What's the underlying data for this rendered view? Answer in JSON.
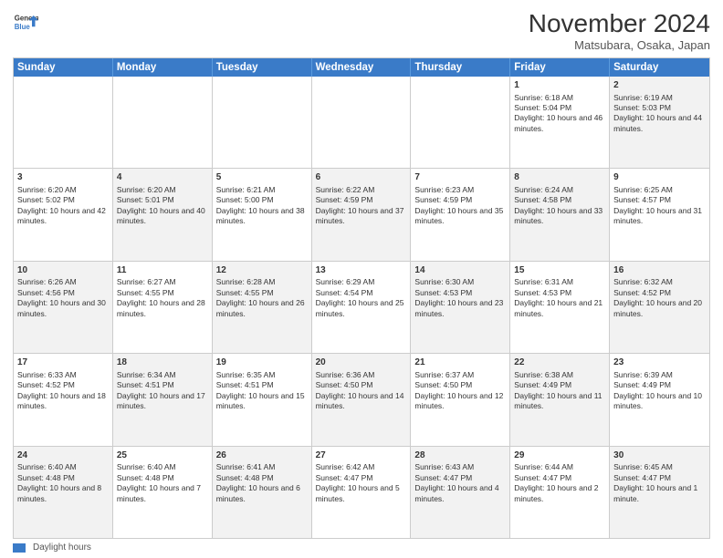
{
  "header": {
    "logo_line1": "General",
    "logo_line2": "Blue",
    "month": "November 2024",
    "location": "Matsubara, Osaka, Japan"
  },
  "weekdays": [
    "Sunday",
    "Monday",
    "Tuesday",
    "Wednesday",
    "Thursday",
    "Friday",
    "Saturday"
  ],
  "weeks": [
    [
      {
        "day": "",
        "info": "",
        "shaded": false,
        "empty": true
      },
      {
        "day": "",
        "info": "",
        "shaded": false,
        "empty": true
      },
      {
        "day": "",
        "info": "",
        "shaded": false,
        "empty": true
      },
      {
        "day": "",
        "info": "",
        "shaded": false,
        "empty": true
      },
      {
        "day": "",
        "info": "",
        "shaded": false,
        "empty": true
      },
      {
        "day": "1",
        "info": "Sunrise: 6:18 AM\nSunset: 5:04 PM\nDaylight: 10 hours and 46 minutes.",
        "shaded": false,
        "empty": false
      },
      {
        "day": "2",
        "info": "Sunrise: 6:19 AM\nSunset: 5:03 PM\nDaylight: 10 hours and 44 minutes.",
        "shaded": true,
        "empty": false
      }
    ],
    [
      {
        "day": "3",
        "info": "Sunrise: 6:20 AM\nSunset: 5:02 PM\nDaylight: 10 hours and 42 minutes.",
        "shaded": false,
        "empty": false
      },
      {
        "day": "4",
        "info": "Sunrise: 6:20 AM\nSunset: 5:01 PM\nDaylight: 10 hours and 40 minutes.",
        "shaded": true,
        "empty": false
      },
      {
        "day": "5",
        "info": "Sunrise: 6:21 AM\nSunset: 5:00 PM\nDaylight: 10 hours and 38 minutes.",
        "shaded": false,
        "empty": false
      },
      {
        "day": "6",
        "info": "Sunrise: 6:22 AM\nSunset: 4:59 PM\nDaylight: 10 hours and 37 minutes.",
        "shaded": true,
        "empty": false
      },
      {
        "day": "7",
        "info": "Sunrise: 6:23 AM\nSunset: 4:59 PM\nDaylight: 10 hours and 35 minutes.",
        "shaded": false,
        "empty": false
      },
      {
        "day": "8",
        "info": "Sunrise: 6:24 AM\nSunset: 4:58 PM\nDaylight: 10 hours and 33 minutes.",
        "shaded": true,
        "empty": false
      },
      {
        "day": "9",
        "info": "Sunrise: 6:25 AM\nSunset: 4:57 PM\nDaylight: 10 hours and 31 minutes.",
        "shaded": false,
        "empty": false
      }
    ],
    [
      {
        "day": "10",
        "info": "Sunrise: 6:26 AM\nSunset: 4:56 PM\nDaylight: 10 hours and 30 minutes.",
        "shaded": true,
        "empty": false
      },
      {
        "day": "11",
        "info": "Sunrise: 6:27 AM\nSunset: 4:55 PM\nDaylight: 10 hours and 28 minutes.",
        "shaded": false,
        "empty": false
      },
      {
        "day": "12",
        "info": "Sunrise: 6:28 AM\nSunset: 4:55 PM\nDaylight: 10 hours and 26 minutes.",
        "shaded": true,
        "empty": false
      },
      {
        "day": "13",
        "info": "Sunrise: 6:29 AM\nSunset: 4:54 PM\nDaylight: 10 hours and 25 minutes.",
        "shaded": false,
        "empty": false
      },
      {
        "day": "14",
        "info": "Sunrise: 6:30 AM\nSunset: 4:53 PM\nDaylight: 10 hours and 23 minutes.",
        "shaded": true,
        "empty": false
      },
      {
        "day": "15",
        "info": "Sunrise: 6:31 AM\nSunset: 4:53 PM\nDaylight: 10 hours and 21 minutes.",
        "shaded": false,
        "empty": false
      },
      {
        "day": "16",
        "info": "Sunrise: 6:32 AM\nSunset: 4:52 PM\nDaylight: 10 hours and 20 minutes.",
        "shaded": true,
        "empty": false
      }
    ],
    [
      {
        "day": "17",
        "info": "Sunrise: 6:33 AM\nSunset: 4:52 PM\nDaylight: 10 hours and 18 minutes.",
        "shaded": false,
        "empty": false
      },
      {
        "day": "18",
        "info": "Sunrise: 6:34 AM\nSunset: 4:51 PM\nDaylight: 10 hours and 17 minutes.",
        "shaded": true,
        "empty": false
      },
      {
        "day": "19",
        "info": "Sunrise: 6:35 AM\nSunset: 4:51 PM\nDaylight: 10 hours and 15 minutes.",
        "shaded": false,
        "empty": false
      },
      {
        "day": "20",
        "info": "Sunrise: 6:36 AM\nSunset: 4:50 PM\nDaylight: 10 hours and 14 minutes.",
        "shaded": true,
        "empty": false
      },
      {
        "day": "21",
        "info": "Sunrise: 6:37 AM\nSunset: 4:50 PM\nDaylight: 10 hours and 12 minutes.",
        "shaded": false,
        "empty": false
      },
      {
        "day": "22",
        "info": "Sunrise: 6:38 AM\nSunset: 4:49 PM\nDaylight: 10 hours and 11 minutes.",
        "shaded": true,
        "empty": false
      },
      {
        "day": "23",
        "info": "Sunrise: 6:39 AM\nSunset: 4:49 PM\nDaylight: 10 hours and 10 minutes.",
        "shaded": false,
        "empty": false
      }
    ],
    [
      {
        "day": "24",
        "info": "Sunrise: 6:40 AM\nSunset: 4:48 PM\nDaylight: 10 hours and 8 minutes.",
        "shaded": true,
        "empty": false
      },
      {
        "day": "25",
        "info": "Sunrise: 6:40 AM\nSunset: 4:48 PM\nDaylight: 10 hours and 7 minutes.",
        "shaded": false,
        "empty": false
      },
      {
        "day": "26",
        "info": "Sunrise: 6:41 AM\nSunset: 4:48 PM\nDaylight: 10 hours and 6 minutes.",
        "shaded": true,
        "empty": false
      },
      {
        "day": "27",
        "info": "Sunrise: 6:42 AM\nSunset: 4:47 PM\nDaylight: 10 hours and 5 minutes.",
        "shaded": false,
        "empty": false
      },
      {
        "day": "28",
        "info": "Sunrise: 6:43 AM\nSunset: 4:47 PM\nDaylight: 10 hours and 4 minutes.",
        "shaded": true,
        "empty": false
      },
      {
        "day": "29",
        "info": "Sunrise: 6:44 AM\nSunset: 4:47 PM\nDaylight: 10 hours and 2 minutes.",
        "shaded": false,
        "empty": false
      },
      {
        "day": "30",
        "info": "Sunrise: 6:45 AM\nSunset: 4:47 PM\nDaylight: 10 hours and 1 minute.",
        "shaded": true,
        "empty": false
      }
    ]
  ],
  "footer": {
    "legend_label": "Daylight hours"
  }
}
